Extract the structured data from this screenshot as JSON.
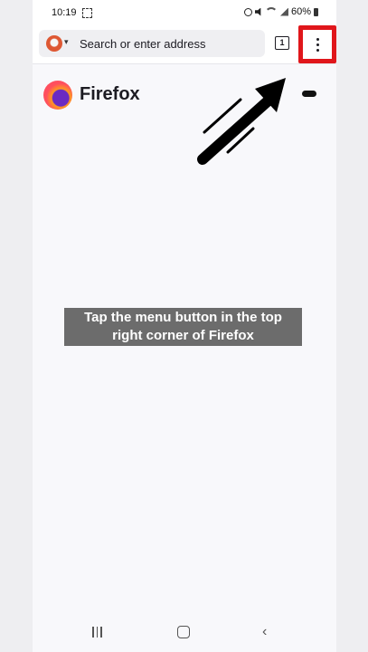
{
  "status_bar": {
    "time": "10:19",
    "battery": "60%",
    "icons": [
      "screenshot-icon",
      "alarm-icon",
      "mute-icon",
      "wifi-icon",
      "signal-icon",
      "battery-icon"
    ]
  },
  "toolbar": {
    "search_engine_icon": "duckduckgo-icon",
    "address_placeholder": "Search or enter address",
    "tab_count": "1",
    "menu_icon": "three-dot-menu-icon",
    "highlight_color": "#e0161b"
  },
  "home": {
    "wordmark": "Firefox",
    "private_icon": "mask-icon"
  },
  "overlay": {
    "caption_line1": "Tap the menu button in the top",
    "caption_line2": "right corner of Firefox",
    "arrow_icon": "arrow-up-right-icon"
  },
  "nav_bar": {
    "icons": [
      "recents-icon",
      "home-icon",
      "back-icon"
    ]
  }
}
